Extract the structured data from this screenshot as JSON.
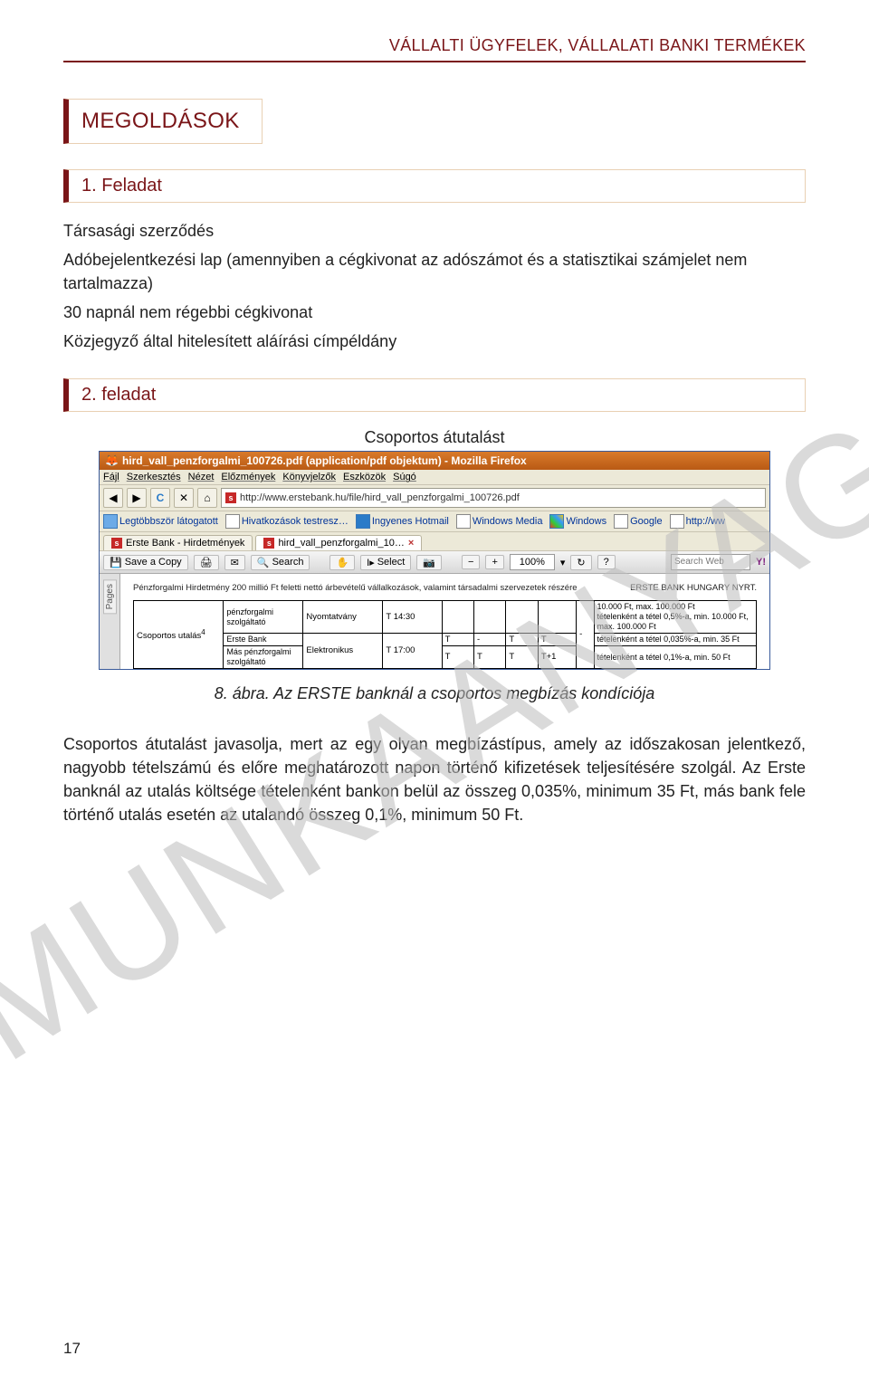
{
  "header": "VÁLLALTI ÜGYFELEK, VÁLLALATI BANKI TERMÉKEK",
  "watermark": "MUNKAANYAG",
  "section_title": "MEGOLDÁSOK",
  "task1": {
    "label": "1. Feladat",
    "lines": [
      "Társasági szerződés",
      "Adóbejelentkezési lap (amennyiben a cégkivonat az adószámot és a statisztikai számjelet nem tartalmazza)",
      "30 napnál nem régebbi cégkivonat",
      "Közjegyző által hitelesített aláírási címpéldány"
    ]
  },
  "task2": {
    "label": "2. feladat",
    "subtitle": "Csoportos átutalást"
  },
  "screenshot": {
    "title": "hird_vall_penzforgalmi_100726.pdf (application/pdf objektum) - Mozilla Firefox",
    "menu": [
      "Fájl",
      "Szerkesztés",
      "Nézet",
      "Előzmények",
      "Könyvjelzők",
      "Eszközök",
      "Súgó"
    ],
    "url": "http://www.erstebank.hu/file/hird_vall_penzforgalmi_100726.pdf",
    "bookmarks": [
      "Legtöbbször látogatott",
      "Hivatkozások testresz…",
      "Ingyenes Hotmail",
      "Windows Media",
      "Windows",
      "Google",
      "http://ww"
    ],
    "tabs": [
      "Erste Bank - Hirdetmények",
      "hird_vall_penzforgalmi_10…"
    ],
    "pdfbar": {
      "save": "Save a Copy",
      "search": "Search",
      "select": "Select",
      "zoom": "100%",
      "search_web": "Search Web"
    },
    "sidebar": "Pages",
    "meta_left": "Pénzforgalmi Hirdetmény 200 millió Ft feletti nettó árbevételű vállalkozások, valamint társadalmi szervezetek részére",
    "meta_right": "ERSTE BANK HUNGARY NYRT.",
    "table": {
      "row0_col2": "pénzforgalmi szolgáltató",
      "row0_col5_l1": "10.000 Ft, max. 100.000 Ft",
      "row0_col5_l2": "tételenként a tétel 0,5%-a, min. 10.000 Ft, max. 100.000 Ft",
      "row0_col3": "Nyomtatvány",
      "row0_col4": "T 14:30",
      "row1_col1": "Csoportos utalás",
      "row1_sup": "4",
      "row1_col2a": "Erste Bank",
      "row1_col3": "Elektronikus",
      "row1_col4": "T 17:00",
      "row1_t": "T",
      "row1_dash": "-",
      "row1_t1": "T+1",
      "row1_col5a": "tételenként a tétel 0,035%-a, min. 35 Ft",
      "row2_col2": "Más pénzforgalmi szolgáltató",
      "row2_col5": "tételenként a tétel 0,1%-a, min. 50 Ft"
    }
  },
  "caption": "8. ábra. Az ERSTE banknál a csoportos megbízás kondíciója",
  "body_paragraph": "Csoportos átutalást javasolja, mert az egy  olyan megbízástípus, amely az időszakosan jelentkező, nagyobb tételszámú és előre meghatározott napon történő kifizetések teljesítésére szolgál. Az Erste banknál az utalás költsége tételenként bankon belül az összeg 0,035%, minimum 35 Ft, más bank fele történő utalás esetén az utalandó összeg  0,1%, minimum 50 Ft.",
  "page_number": "17"
}
